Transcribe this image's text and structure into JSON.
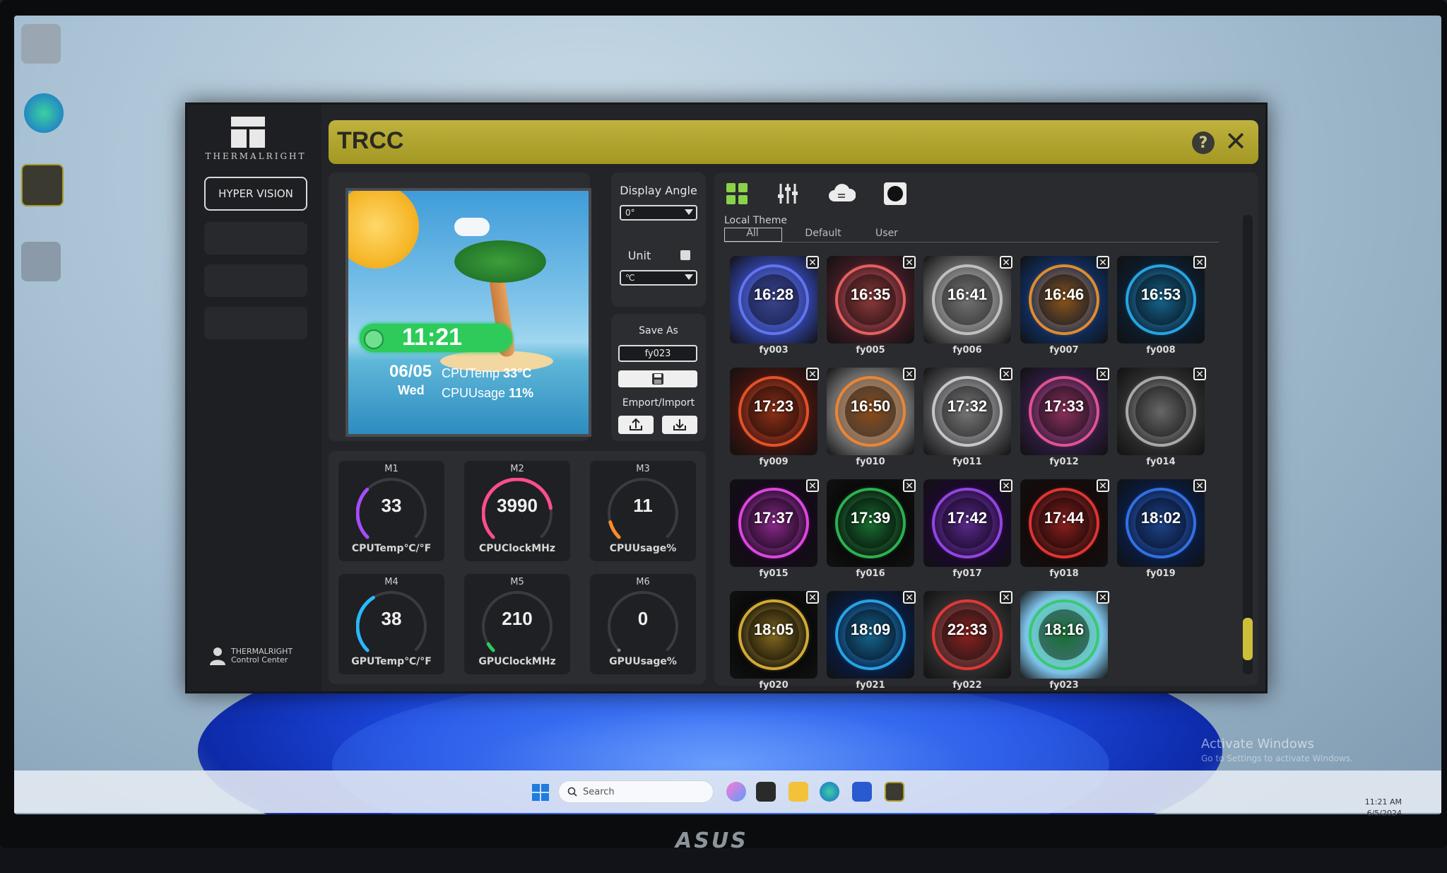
{
  "app": {
    "title": "TRCC",
    "brand": "THERMALRIGHT",
    "help_icon": "?",
    "close_icon": "✕"
  },
  "sidebar": {
    "hyper_vision_label": "HYPER VISION",
    "control_center_line1": "THERMALRIGHT",
    "control_center_line2": "Control Center"
  },
  "preview": {
    "time": "11:21",
    "date": "06/05",
    "day": "Wed",
    "cputemp_label": "CPUTemp",
    "cputemp_value": "33°C",
    "cpuusage_label": "CPUUsage",
    "cpuusage_value": "11%"
  },
  "settings": {
    "display_angle_label": "Display Angle",
    "display_angle_value": "0°",
    "unit_label": "Unit",
    "unit_value": "℃"
  },
  "save": {
    "save_as_label": "Save As",
    "save_as_value": "fy023",
    "export_import_label": "Emport/Import"
  },
  "gauges": [
    {
      "slot": "M1",
      "value": "33",
      "label": "CPUTemp℃/°F",
      "fraction": 0.33,
      "color": "#a64dff"
    },
    {
      "slot": "M2",
      "value": "3990",
      "label": "CPUClockMHz",
      "fraction": 0.8,
      "color": "#ff4d8d"
    },
    {
      "slot": "M3",
      "value": "11",
      "label": "CPUUsage%",
      "fraction": 0.11,
      "color": "#ff8a2a"
    },
    {
      "slot": "M4",
      "value": "38",
      "label": "GPUTemp℃/°F",
      "fraction": 0.38,
      "color": "#2ab8ff"
    },
    {
      "slot": "M5",
      "value": "210",
      "label": "GPUClockMHz",
      "fraction": 0.05,
      "color": "#2ecb5a"
    },
    {
      "slot": "M6",
      "value": "0",
      "label": "GPUUsage%",
      "fraction": 0.0,
      "color": "#888888"
    }
  ],
  "themes": {
    "section_label": "Local Theme",
    "tabs": [
      "All",
      "Default",
      "User"
    ],
    "active_tab": "All",
    "items": [
      {
        "name": "fy003",
        "time": "16:28",
        "bg": "#2b3a8a",
        "accent": "#6a7cff"
      },
      {
        "name": "fy005",
        "time": "16:35",
        "bg": "#3a1a22",
        "accent": "#ff6a6a"
      },
      {
        "name": "fy006",
        "time": "16:41",
        "bg": "#5a5a5a",
        "accent": "#cfcfcf"
      },
      {
        "name": "fy007",
        "time": "16:46",
        "bg": "#102a55",
        "accent": "#ff9a2a"
      },
      {
        "name": "fy008",
        "time": "16:53",
        "bg": "#0d1b2a",
        "accent": "#2ab8ff"
      },
      {
        "name": "fy009",
        "time": "17:23",
        "bg": "#3a1410",
        "accent": "#ff5a2a"
      },
      {
        "name": "fy010",
        "time": "16:50",
        "bg": "#6a6a6a",
        "accent": "#ff8a2a"
      },
      {
        "name": "fy011",
        "time": "17:32",
        "bg": "#4a4a4e",
        "accent": "#d8d8d8"
      },
      {
        "name": "fy012",
        "time": "17:33",
        "bg": "#2a1a3a",
        "accent": "#ff5aa0"
      },
      {
        "name": "fy014",
        "time": "",
        "bg": "#2a2a2a",
        "accent": "#bcbcbc"
      },
      {
        "name": "fy015",
        "time": "17:37",
        "bg": "#140a1a",
        "accent": "#ff4dff"
      },
      {
        "name": "fy016",
        "time": "17:39",
        "bg": "#0a0a0a",
        "accent": "#2ecb5a"
      },
      {
        "name": "fy017",
        "time": "17:42",
        "bg": "#1a0a2a",
        "accent": "#a64dff"
      },
      {
        "name": "fy018",
        "time": "17:44",
        "bg": "#140a0a",
        "accent": "#ff3a3a"
      },
      {
        "name": "fy019",
        "time": "18:02",
        "bg": "#0a1a3a",
        "accent": "#3a7cff"
      },
      {
        "name": "fy020",
        "time": "18:05",
        "bg": "#0a0a0a",
        "accent": "#f0c23a"
      },
      {
        "name": "fy021",
        "time": "18:09",
        "bg": "#0a1a3a",
        "accent": "#2ab8ff"
      },
      {
        "name": "fy022",
        "time": "22:33",
        "bg": "#2a2a2a",
        "accent": "#ff3a3a"
      },
      {
        "name": "fy023",
        "time": "18:16",
        "bg": "#7ec3ea",
        "accent": "#2ecb5a"
      }
    ]
  },
  "taskbar": {
    "search_placeholder": "Search",
    "time": "11:21 AM",
    "date": "6/5/2024"
  },
  "watermark": {
    "line1": "Activate Windows",
    "line2": "Go to Settings to activate Windows."
  },
  "monitor_brand": "ASUS"
}
